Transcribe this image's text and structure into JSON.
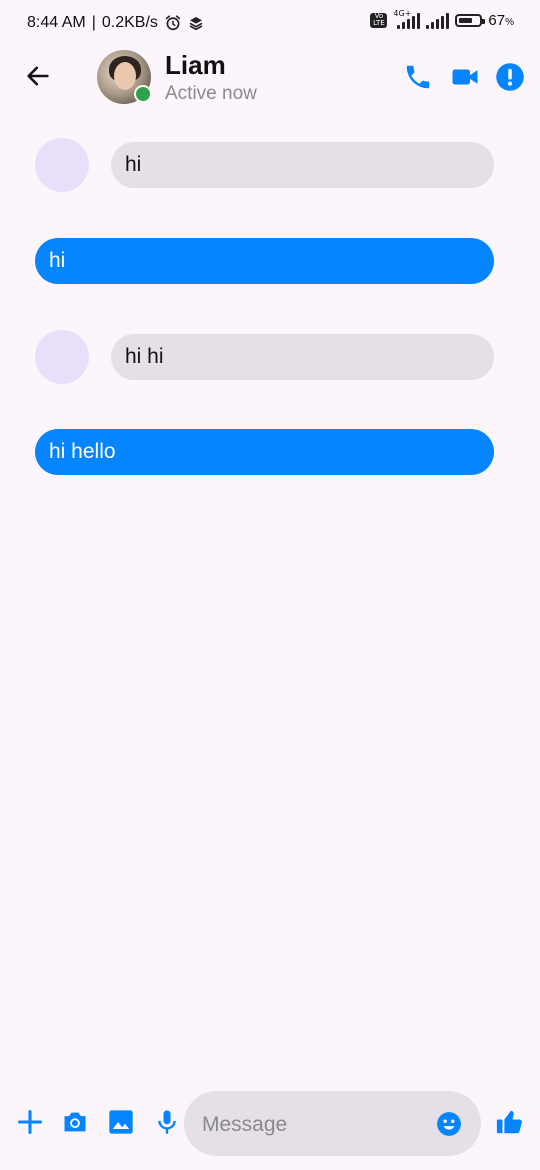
{
  "status_bar": {
    "time": "8:44 AM",
    "speed": "0.2KB/s",
    "network": "4G+",
    "volte": "Vo LTE",
    "battery": "67",
    "battery_unit": "%",
    "battery_level": 0.67
  },
  "header": {
    "name": "Liam",
    "status": "Active now",
    "icons": [
      "back-arrow-icon",
      "phone-icon",
      "video-camera-icon",
      "info-icon"
    ]
  },
  "messages": [
    {
      "direction": "incoming",
      "text": "hi"
    },
    {
      "direction": "outgoing",
      "text": "hi"
    },
    {
      "direction": "incoming",
      "text": "hi hi"
    },
    {
      "direction": "outgoing",
      "text": "hi hello"
    }
  ],
  "composer": {
    "placeholder": "Message",
    "value": "",
    "icons": [
      "plus-icon",
      "camera-icon",
      "gallery-icon",
      "microphone-icon",
      "emoji-icon",
      "thumbs-up-icon"
    ]
  },
  "colors": {
    "accent": "#0484ff",
    "incoming_bubble": "#e5e0e7",
    "background": "#fcf5fc",
    "online": "#31a24c"
  }
}
